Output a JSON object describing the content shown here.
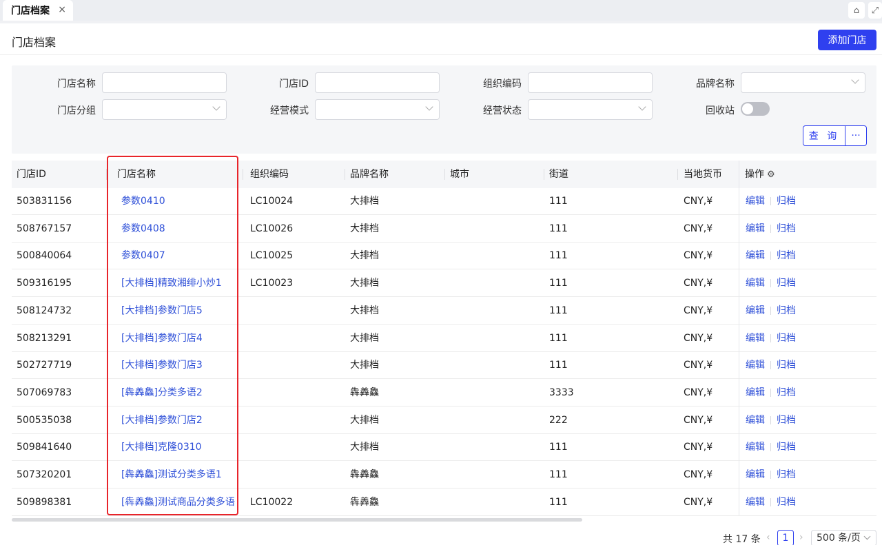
{
  "tab": {
    "label": "门店档案",
    "close": "×"
  },
  "top_icons": [
    {
      "icon": "building-icon",
      "glyph": "⌂"
    },
    {
      "icon": "fullscreen-icon",
      "glyph": "⤢"
    }
  ],
  "header": {
    "title": "门店档案",
    "add_label": "添加门店"
  },
  "filters": {
    "store_name": "门店名称",
    "store_id": "门店ID",
    "org_code": "组织编码",
    "brand_name": "品牌名称",
    "store_group": "门店分组",
    "biz_mode": "经营模式",
    "biz_status": "经营状态",
    "recycle": "回收站",
    "query_label": "查 询",
    "more_label": "···"
  },
  "table": {
    "columns": [
      "门店ID",
      "门店名称",
      "组织编码",
      "品牌名称",
      "城市",
      "街道",
      "当地货币",
      "操作"
    ],
    "edit_label": "编辑",
    "archive_label": "归档",
    "rows": [
      {
        "id": "503831156",
        "name": "参数0410",
        "org": "LC10024",
        "brand": "大排档",
        "city": "",
        "street": "111",
        "currency": "CNY,¥"
      },
      {
        "id": "508767157",
        "name": "参数0408",
        "org": "LC10026",
        "brand": "大排档",
        "city": "",
        "street": "111",
        "currency": "CNY,¥"
      },
      {
        "id": "500840064",
        "name": "参数0407",
        "org": "LC10025",
        "brand": "大排档",
        "city": "",
        "street": "111",
        "currency": "CNY,¥"
      },
      {
        "id": "509316195",
        "name": "[大排档]精致湘绯小炒1",
        "org": "LC10023",
        "brand": "大排档",
        "city": "",
        "street": "111",
        "currency": "CNY,¥"
      },
      {
        "id": "508124732",
        "name": "[大排档]参数门店5",
        "org": "",
        "brand": "大排档",
        "city": "",
        "street": "111",
        "currency": "CNY,¥"
      },
      {
        "id": "508213291",
        "name": "[大排档]参数门店4",
        "org": "",
        "brand": "大排档",
        "city": "",
        "street": "111",
        "currency": "CNY,¥"
      },
      {
        "id": "502727719",
        "name": "[大排档]参数门店3",
        "org": "",
        "brand": "大排档",
        "city": "",
        "street": "111",
        "currency": "CNY,¥"
      },
      {
        "id": "507069783",
        "name": "[犇羴鱻]分类多语2",
        "org": "",
        "brand": "犇羴鱻",
        "city": "",
        "street": "3333",
        "currency": "CNY,¥"
      },
      {
        "id": "500535038",
        "name": "[大排档]参数门店2",
        "org": "",
        "brand": "大排档",
        "city": "",
        "street": "222",
        "currency": "CNY,¥"
      },
      {
        "id": "509841640",
        "name": "[大排档]克隆0310",
        "org": "",
        "brand": "大排档",
        "city": "",
        "street": "111",
        "currency": "CNY,¥"
      },
      {
        "id": "507320201",
        "name": "[犇羴鱻]测试分类多语1",
        "org": "",
        "brand": "犇羴鱻",
        "city": "",
        "street": "111",
        "currency": "CNY,¥"
      },
      {
        "id": "509898381",
        "name": "[犇羴鱻]测试商品分类多语",
        "org": "LC10022",
        "brand": "犇羴鱻",
        "city": "",
        "street": "111",
        "currency": "CNY,¥"
      }
    ]
  },
  "pagination": {
    "total": "共 17 条",
    "prev": "‹",
    "current": "1",
    "next": "›",
    "page_size": "500 条/页"
  },
  "colors": {
    "primary": "#2f40ef",
    "link": "#2f50d8",
    "highlight": "#e8242a"
  }
}
